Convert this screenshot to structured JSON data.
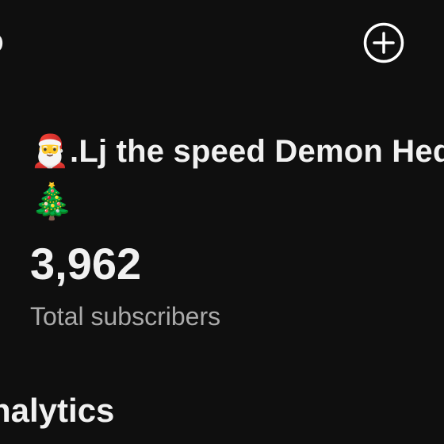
{
  "header": {
    "partial_text": "o",
    "add_icon": "plus-circle-icon"
  },
  "channel": {
    "name_prefix_emoji": "🎅",
    "name_text": ".Lj the speed Demon Hed",
    "name_suffix_emoji": "🎄"
  },
  "stats": {
    "subscriber_count": "3,962",
    "subscriber_label": "Total subscribers"
  },
  "section": {
    "title": "nalytics"
  },
  "colors": {
    "background": "#0f0f0f",
    "text_primary": "#f1f1f1",
    "text_secondary": "#aaaaaa"
  }
}
